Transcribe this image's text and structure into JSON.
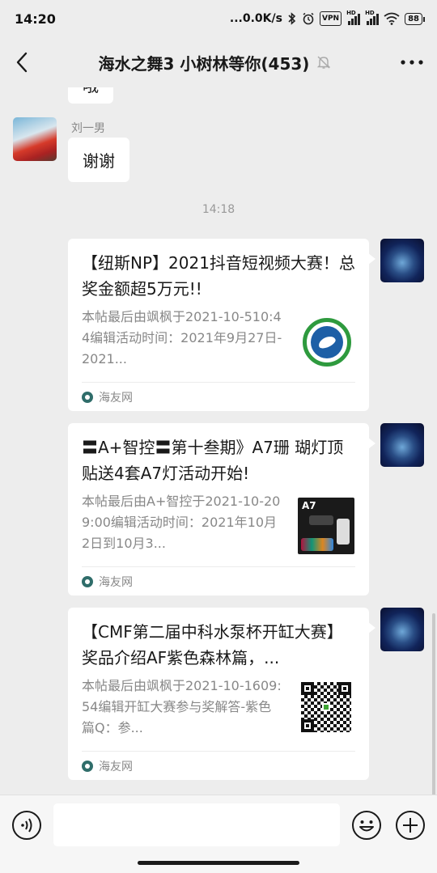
{
  "status_bar": {
    "time": "14:20",
    "network_speed": "...0.0K/s",
    "vpn_label": "VPN",
    "hd_label": "HD",
    "battery": "88",
    "icons": [
      "bluetooth-icon",
      "alarm-icon",
      "vpn-icon",
      "signal-icon",
      "signal-icon",
      "wifi-icon",
      "battery-icon"
    ]
  },
  "header": {
    "title": "海水之舞3 小树林等你(453)",
    "icons": [
      "back-arrow-icon",
      "mute-bell-icon",
      "more-icon"
    ]
  },
  "chat": {
    "partial_message": "哦",
    "messages": [
      {
        "sender": "刘一男",
        "text": "谢谢"
      }
    ],
    "timestamp": "14:18",
    "cards": [
      {
        "title": "【纽斯NP】2021抖音短视频大赛！总奖金额超5万元!!",
        "description": "本帖最后由飒枫于2021-10-510:44编辑活动时间：2021年9月27日-2021...",
        "source": "海友网",
        "thumbnail": "green-fish-logo"
      },
      {
        "title": "〓A+智控〓第十叁期》A7珊 瑚灯顶贴送4套A7灯活动开始!",
        "description": "本帖最后由A+智控于2021-10-209:00编辑活动时间：2021年10月2日到10月3...",
        "source": "海友网",
        "thumbnail": "A7",
        "thumbnail_label": "A7"
      },
      {
        "title": "【CMF第二届中科水泵杯开缸大赛】奖品介绍AF紫色森林篇，...",
        "description": "本帖最后由飒枫于2021-10-1609:54编辑开缸大赛参与奖解答-紫色篇Q：参...",
        "source": "海友网",
        "thumbnail": "qr-code"
      }
    ]
  },
  "input_bar": {
    "value": "",
    "icons": [
      "voice-icon",
      "emoji-icon",
      "plus-icon"
    ]
  },
  "colors": {
    "background": "#ededed",
    "bubble": "#ffffff",
    "muted_text": "#888888"
  }
}
